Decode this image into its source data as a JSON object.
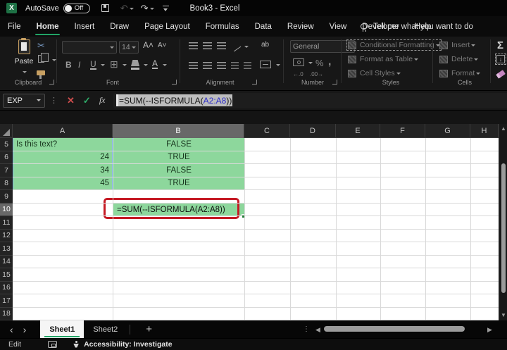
{
  "titlebar": {
    "autosave": "AutoSave",
    "autosave_state": "Off",
    "title": "Book3  -  Excel"
  },
  "tabs": [
    "File",
    "Home",
    "Insert",
    "Draw",
    "Page Layout",
    "Formulas",
    "Data",
    "Review",
    "View",
    "Developer",
    "Help"
  ],
  "active_tab": "Home",
  "search": {
    "label": "Tell me what you want to do"
  },
  "ribbon": {
    "clipboard": {
      "label": "Clipboard",
      "paste": "Paste"
    },
    "font": {
      "label": "Font",
      "size": "14",
      "bold": "B",
      "italic": "I",
      "underline": "U",
      "grow": "A",
      "shrink": "A",
      "color": "A",
      "borders": "⊞"
    },
    "alignment": {
      "label": "Alignment",
      "wrap": "ab"
    },
    "number": {
      "label": "Number",
      "format": "General",
      "percent": "%",
      "comma": ",",
      "inc_dec": "←.0",
      "dec_dec": ".00→"
    },
    "styles": {
      "label": "Styles",
      "items": [
        "Conditional Formatting",
        "Format as Table",
        "Cell Styles"
      ]
    },
    "cells": {
      "label": "Cells",
      "items": [
        "Insert",
        "Delete",
        "Format"
      ]
    },
    "editing": {
      "autosum": "Σ",
      "filldown": "↓"
    }
  },
  "formula_bar": {
    "name_box": "EXP",
    "cancel": "✕",
    "enter": "✓",
    "fx": "fx",
    "dots": "⋮",
    "prefix": "=SUM(--ISFORMULA(",
    "ref": "A2:A8",
    "suffix": "))"
  },
  "grid": {
    "columns": [
      "A",
      "B",
      "C",
      "D",
      "E",
      "F",
      "G",
      "H"
    ],
    "selected_column": "B",
    "row_start": 5,
    "row_end": 18,
    "selected_row": 10,
    "col_a_cells": [
      {
        "row": 5,
        "value": "Is this text?",
        "align": "left"
      },
      {
        "row": 6,
        "value": "24",
        "align": "right"
      },
      {
        "row": 7,
        "value": "34",
        "align": "right"
      },
      {
        "row": 8,
        "value": "45",
        "align": "right"
      }
    ],
    "col_b_cells": [
      {
        "row": 5,
        "value": "FALSE",
        "align": "center"
      },
      {
        "row": 6,
        "value": "TRUE",
        "align": "center"
      },
      {
        "row": 7,
        "value": "FALSE",
        "align": "center"
      },
      {
        "row": 8,
        "value": "TRUE",
        "align": "center"
      }
    ],
    "active_cell": {
      "column": "B",
      "row": 10,
      "value": "=SUM(--ISFORMULA(A2:A8))"
    },
    "referenced_range": "A2:A8"
  },
  "sheets": {
    "tabs": [
      "Sheet1",
      "Sheet2"
    ],
    "active": "Sheet1",
    "add": "+"
  },
  "scroll": {
    "up": "▲",
    "down": "▼",
    "left": "◀",
    "right": "▶",
    "dots": "⋮"
  },
  "status": {
    "mode": "Edit",
    "accessibility": "Accessibility: Investigate"
  },
  "nav": {
    "prev": "‹",
    "next": "›"
  },
  "colors": {
    "accent_green": "#21A366",
    "cell_fill_green": "#8DD79C",
    "annotation_red": "#C51A24",
    "reference_text_blue": "#2D2DC8",
    "reference_border_blue": "#7FB2E5"
  }
}
